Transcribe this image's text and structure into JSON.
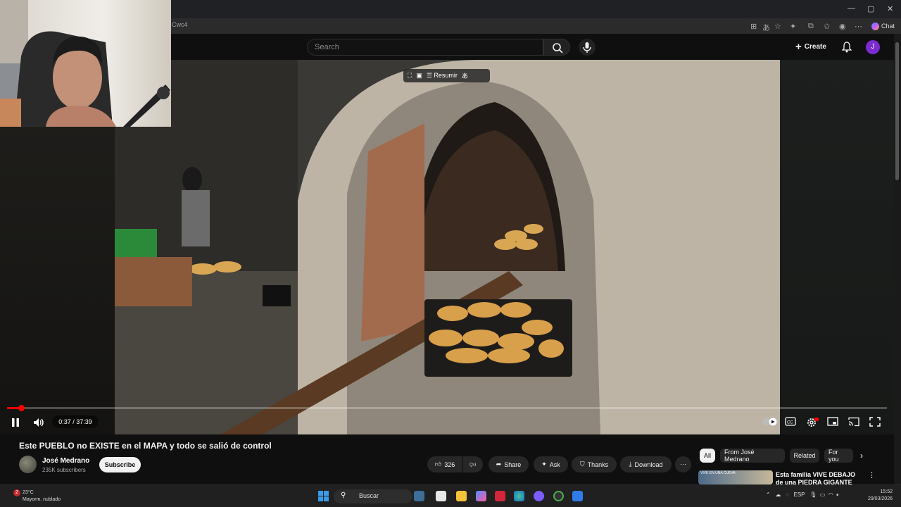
{
  "browser": {
    "url_fragment": "Cwc4",
    "chat_label": "Chat",
    "window_controls": [
      "minimize-icon",
      "maximize-icon",
      "close-icon"
    ]
  },
  "youtube_header": {
    "search_placeholder": "Search",
    "create_label": "Create",
    "avatar_initial": "J"
  },
  "player": {
    "overlay_summary_label": "Resumir",
    "time_display": "0:37 / 37:39",
    "progress_fraction": 0.016,
    "state": "playing"
  },
  "video": {
    "title": "Este PUEBLO no EXISTE en el MAPA y todo se salió de control",
    "channel_name": "José Medrano",
    "subscribers": "235K subscribers",
    "subscribe_label": "Subscribe",
    "like_count": "326",
    "share_label": "Share",
    "ask_label": "Ask",
    "thanks_label": "Thanks",
    "download_label": "Download"
  },
  "chips": [
    "All",
    "From José Medrano",
    "Related",
    "For you"
  ],
  "recommendation": {
    "title": "Esta familia VIVE DEBAJO de una PIEDRA GIGANTE",
    "thumb_text": "VIVE EN UNA CUEVA"
  },
  "taskbar": {
    "weather_temp": "23°C",
    "weather_desc": "Mayorm. nublado",
    "weather_badge": "2",
    "search_label": "Buscar",
    "language": "ESP",
    "time": "15:52",
    "date": "29/03/2026"
  },
  "colors": {
    "accent_red": "#ff0000",
    "avatar_purple": "#7b2ccf"
  }
}
